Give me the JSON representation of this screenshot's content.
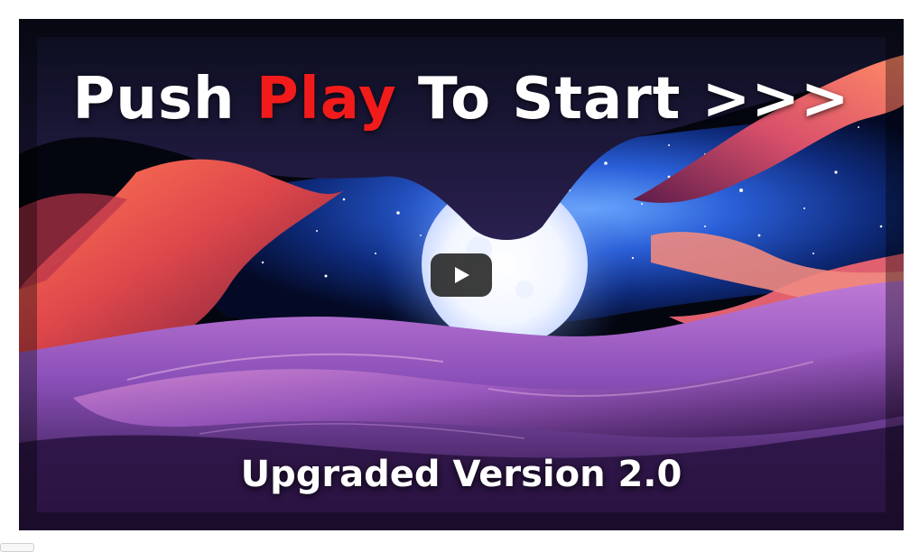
{
  "video": {
    "headline_part1": "Push ",
    "headline_highlight": "Play",
    "headline_part2": " To Start >>>",
    "subtitle": "Upgraded Version 2.0",
    "highlight_color": "#f21b1b",
    "play_button_icon": "play-icon"
  }
}
